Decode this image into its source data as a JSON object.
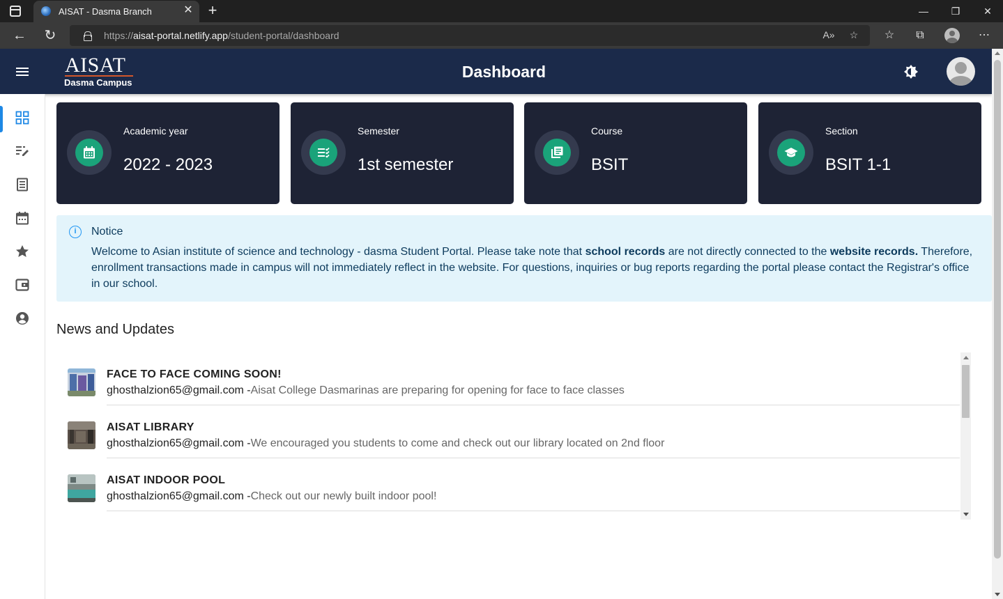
{
  "browser": {
    "tab_title": "AISAT - Dasma Branch",
    "tab_close": "✕",
    "new_tab": "+",
    "url_scheme": "https://",
    "url_host": "aisat-portal.netlify.app",
    "url_path": "/student-portal/dashboard",
    "window_controls": {
      "minimize": "—",
      "restore": "❐",
      "close": "✕"
    }
  },
  "header": {
    "logo_main": "AISAT",
    "logo_sub": "Dasma Campus",
    "title": "Dashboard"
  },
  "sidebar": {
    "items": [
      {
        "name": "dashboard",
        "icon": "grid-icon",
        "active": true
      },
      {
        "name": "grades",
        "icon": "edit-list-icon"
      },
      {
        "name": "records",
        "icon": "document-icon"
      },
      {
        "name": "schedule",
        "icon": "calendar-icon"
      },
      {
        "name": "favorites",
        "icon": "star-icon"
      },
      {
        "name": "wallet",
        "icon": "wallet-icon"
      },
      {
        "name": "profile",
        "icon": "account-icon"
      }
    ]
  },
  "cards": [
    {
      "label": "Academic year",
      "value": "2022 - 2023",
      "icon": "calendar-icon"
    },
    {
      "label": "Semester",
      "value": "1st semester",
      "icon": "checklist-icon"
    },
    {
      "label": "Course",
      "value": "BSIT",
      "icon": "library-books-icon"
    },
    {
      "label": "Section",
      "value": "BSIT 1-1",
      "icon": "graduation-cap-icon"
    }
  ],
  "notice": {
    "title": "Notice",
    "body_1": "Welcome to Asian institute of science and technology - dasma Student Portal. Please take note that ",
    "bold_1": "school records",
    "body_2": " are not directly connected to the ",
    "bold_2": "website records.",
    "body_3": " Therefore, enrollment transactions made in campus will not immediately reflect in the website. For questions, inquiries or bug reports regarding the portal please contact the Registrar's office in our school."
  },
  "news": {
    "heading": "News and Updates",
    "items": [
      {
        "title": "FACE TO FACE COMING SOON!",
        "author": "ghosthalzion65@gmail.com -",
        "desc": "Aisat College Dasmarinas are preparing for opening for face to face classes"
      },
      {
        "title": "AISAT LIBRARY",
        "author": "ghosthalzion65@gmail.com -",
        "desc": "We encouraged you students to come and check out our library located on 2nd floor"
      },
      {
        "title": "AISAT INDOOR POOL",
        "author": "ghosthalzion65@gmail.com -",
        "desc": "Check out our newly built indoor pool!"
      }
    ]
  },
  "colors": {
    "header_bg": "#1b2a4a",
    "card_bg": "#1e2335",
    "icon_accent": "#1aa37a",
    "notice_bg": "#e3f4fb",
    "active_indicator": "#1e88e5"
  }
}
